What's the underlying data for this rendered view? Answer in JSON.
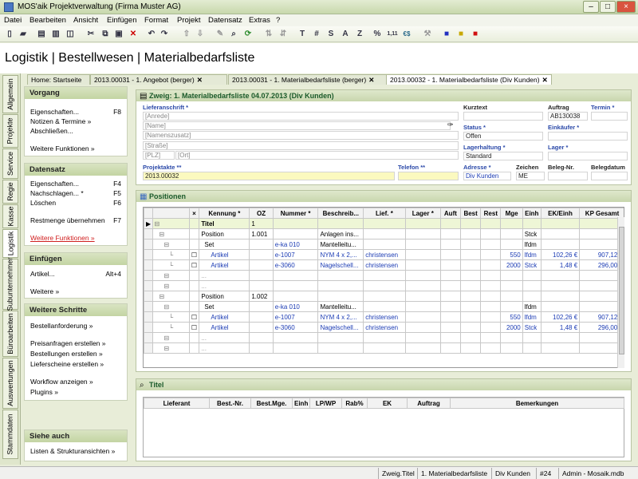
{
  "window": {
    "title": "MOS'aik Projektverwaltung (Firma Muster AG)"
  },
  "menu": [
    "Datei",
    "Bearbeiten",
    "Ansicht",
    "Einfügen",
    "Format",
    "Projekt",
    "Datensatz",
    "Extras",
    "?"
  ],
  "toolbar": {
    "text_buttons": [
      "T",
      "#",
      "S",
      "A",
      "Z",
      "%",
      "1,11",
      "€$"
    ]
  },
  "page_title": "Logistik | Bestellwesen | Materialbedarfsliste",
  "left_tabs": [
    "Allgemein",
    "Projekte",
    "Service",
    "Regie",
    "Kasse",
    "Logistik",
    "Subunternehmer",
    "Büroarbeiten",
    "Auswertungen",
    "Stammdaten"
  ],
  "doc_tabs": [
    "Home: Startseite",
    "2013.00031 - 1. Angebot (berger)",
    "2013.00031 - 1. Materialbedarfsliste (berger)",
    "2013.00032 - 1. Materialbedarfsliste (Div Kunden)"
  ],
  "sidebar": {
    "vorgang": {
      "title": "Vorgang",
      "items": [
        {
          "label": "Eigenschaften...",
          "key": "F8"
        },
        {
          "label": "Notizen & Termine »"
        },
        {
          "label": "Abschließen..."
        },
        {
          "label": "Weitere Funktionen »"
        }
      ]
    },
    "datensatz": {
      "title": "Datensatz",
      "items": [
        {
          "label": "Eigenschaften...",
          "key": "F4"
        },
        {
          "label": "Nachschlagen... *",
          "key": "F5"
        },
        {
          "label": "Löschen",
          "key": "F6"
        },
        {
          "label": "Restmenge übernehmen",
          "key": "F7"
        },
        {
          "label": "Weitere Funktionen »"
        }
      ]
    },
    "einfuegen": {
      "title": "Einfügen",
      "items": [
        {
          "label": "Artikel...",
          "key": "Alt+4"
        },
        {
          "label": "Weitere »"
        }
      ]
    },
    "weitere_schritte": {
      "title": "Weitere Schritte",
      "items": [
        {
          "label": "Bestellanforderung »"
        },
        {
          "label": "Preisanfragen erstellen »"
        },
        {
          "label": "Bestellungen erstellen »"
        },
        {
          "label": "Lieferscheine erstellen »"
        },
        {
          "label": "Workflow anzeigen »"
        },
        {
          "label": "Plugins »"
        }
      ]
    },
    "siehe_auch": {
      "title": "Siehe auch",
      "items": [
        {
          "label": "Listen & Strukturansichten »"
        }
      ]
    }
  },
  "header": {
    "title": "Zweig: 1. Materialbedarfsliste 04.07.2013 (Div Kunden)",
    "lieferanschrift_label": "Lieferanschrift *",
    "placeholders": {
      "anrede": "[Anrede]",
      "name": "[Name]",
      "namenszusatz": "[Namenszusatz]",
      "strasse": "[Straße]",
      "plz": "[PLZ]",
      "ort": "[Ort]"
    },
    "kurztext_label": "Kurztext",
    "kurztext": "",
    "auftrag_label": "Auftrag",
    "auftrag": "AB130038",
    "termin_label": "Termin *",
    "termin": "",
    "status_label": "Status *",
    "status": "Offen",
    "einkaeufer_label": "Einkäufer *",
    "einkaeufer": "",
    "lagerhaltung_label": "Lagerhaltung *",
    "lagerhaltung": "Standard",
    "lager_label": "Lager *",
    "lager": "",
    "projektakte_label": "Projektakte **",
    "projektakte": "2013.00032",
    "telefon_label": "Telefon **",
    "telefon": "",
    "adresse_label": "Adresse *",
    "adresse": "Div Kunden",
    "zeichen_label": "Zeichen",
    "zeichen": "ME",
    "belegnr_label": "Beleg-Nr.",
    "belegnr": "",
    "belegdatum_label": "Belegdatum",
    "belegdatum": ""
  },
  "positionen": {
    "title": "Positionen",
    "columns": [
      "",
      "",
      "×",
      "Kennung *",
      "OZ",
      "Nummer *",
      "Beschreib...",
      "Lief. *",
      "Lager *",
      "Auft",
      "Best",
      "Rest",
      "Mge",
      "Einh",
      "EK/Einh",
      "KP Gesamt"
    ],
    "rows": [
      {
        "type": "title",
        "kennung": "Titel",
        "oz": "1"
      },
      {
        "type": "position",
        "kennung": "Position",
        "oz": "1.001",
        "beschr": "Anlagen ins...",
        "einh": "Stck"
      },
      {
        "type": "set",
        "kennung": "Set",
        "nummer": "e-ka 010",
        "beschr": "Mantelleitu...",
        "einh": "lfdm"
      },
      {
        "type": "artikel",
        "kennung": "Artikel",
        "nummer": "e-1007",
        "beschr": "NYM 4 x 2,...",
        "lief": "christensen",
        "mge": "550",
        "einh": "lfdm",
        "ek": "102,26 €",
        "kp": "907,12 €"
      },
      {
        "type": "artikel",
        "kennung": "Artikel",
        "nummer": "e-3060",
        "beschr": "Nagelschell...",
        "lief": "christensen",
        "mge": "2000",
        "einh": "Stck",
        "ek": "1,48 €",
        "kp": "296,00 €"
      },
      {
        "type": "more",
        "kennung": "..."
      },
      {
        "type": "more",
        "kennung": "..."
      },
      {
        "type": "position",
        "kennung": "Position",
        "oz": "1.002"
      },
      {
        "type": "set",
        "kennung": "Set",
        "nummer": "e-ka 010",
        "beschr": "Mantelleitu...",
        "einh": "lfdm"
      },
      {
        "type": "artikel",
        "kennung": "Artikel",
        "nummer": "e-1007",
        "beschr": "NYM 4 x 2,...",
        "lief": "christensen",
        "mge": "550",
        "einh": "lfdm",
        "ek": "102,26 €",
        "kp": "907,12 €"
      },
      {
        "type": "artikel",
        "kennung": "Artikel",
        "nummer": "e-3060",
        "beschr": "Nagelschell...",
        "lief": "christensen",
        "mge": "2000",
        "einh": "Stck",
        "ek": "1,48 €",
        "kp": "296,00 €"
      },
      {
        "type": "more",
        "kennung": "..."
      },
      {
        "type": "more",
        "kennung": "..."
      }
    ]
  },
  "titel_panel": {
    "title": "Titel",
    "columns": [
      "Lieferant",
      "Best.-Nr.",
      "Best.Mge.",
      "Einh",
      "LP/WP",
      "Rab%",
      "EK",
      "Auftrag",
      "Bemerkungen"
    ]
  },
  "statusbar": [
    "Zweig.Titel",
    "1. Materialbedarfsliste",
    "Div Kunden",
    "#24",
    "Admin - Mosaik.mdb"
  ]
}
